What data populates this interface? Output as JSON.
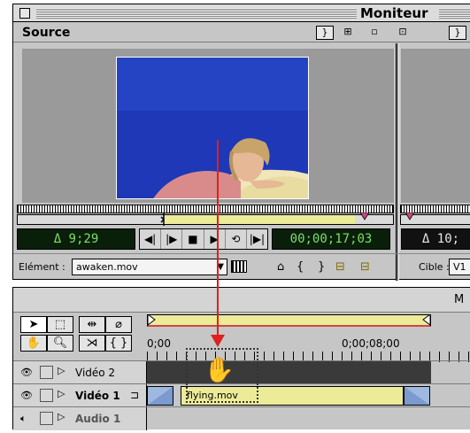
{
  "monitor": {
    "title": "Moniteur",
    "source_label": "Source",
    "source_header_buttons": [
      "}",
      "⊞",
      "▫",
      "⊡",
      "}"
    ],
    "timecodes": {
      "duration": "Δ 9;29",
      "current": "00;00;17;03",
      "program_duration": "Δ 10;"
    },
    "transport": [
      "◀|",
      "|▶",
      "■",
      "▶",
      "⟲",
      "|▶|"
    ],
    "element_label": "Elément :",
    "element_file": "awaken.mov",
    "target_label": "Cible :",
    "target_value": "V1",
    "element_buttons": [
      "⌂",
      "{",
      "}",
      "⊟",
      "⊟"
    ]
  },
  "timeline": {
    "title": "M",
    "ruler_labels": [
      "0;00",
      "0;00;08;00"
    ],
    "tracks": [
      {
        "name": "Vidéo 2",
        "bold": false
      },
      {
        "name": "Vidéo 1",
        "bold": true
      },
      {
        "name": "Audio 1",
        "bold": false
      }
    ],
    "clip_name": "flying.mov"
  },
  "colors": {
    "timecode_green": "#7ddf6a",
    "drag_arrow": "#e01f1f",
    "in_out_yellow": "#ecec98",
    "video_blue": "#1e38b8"
  }
}
